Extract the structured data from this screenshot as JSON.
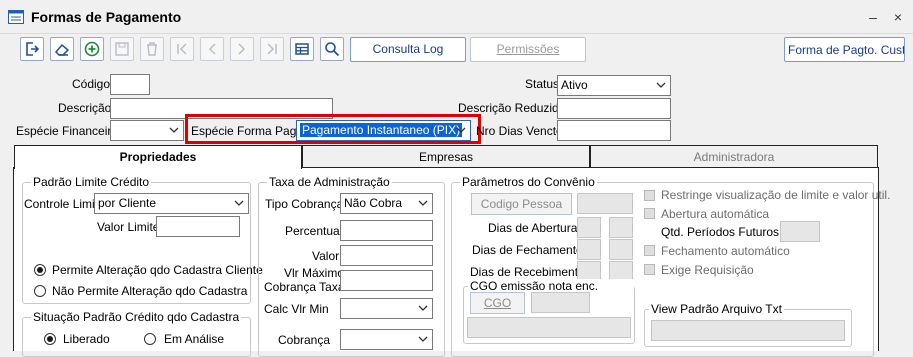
{
  "window": {
    "title": "Formas de Pagamento",
    "minimize_glyph": "–",
    "close_glyph": "×"
  },
  "toolbar": {
    "icons": [
      "exit-icon",
      "eraser-icon",
      "add-icon",
      "save-icon",
      "delete-icon",
      "first-icon",
      "previous-icon",
      "next-icon",
      "last-icon",
      "grid-icon",
      "search-icon"
    ],
    "consulta_log": "Consulta Log",
    "permissoes": "Permissões",
    "forma_pagto_custom": "Forma de Pagto. Custom"
  },
  "form": {
    "codigo_label": "Código",
    "codigo_value": "",
    "status_label": "Status",
    "status_value": "Ativo",
    "descricao_label": "Descrição",
    "descricao_value": "",
    "descricao_reduzida_label": "Descrição Reduzida",
    "descricao_reduzida_value": "",
    "especie_financeira_label": "Espécie Financeira",
    "especie_financeira_value": "",
    "especie_forma_pagto_label": "Espécie Forma Pagto",
    "especie_forma_pagto_value": "Pagamento Instantaneo (PIX)",
    "nro_dias_vencto_label": "Nro Dias Vencto",
    "nro_dias_vencto_value": ""
  },
  "tabs": [
    {
      "label": "Propriedades",
      "active": true
    },
    {
      "label": "Empresas",
      "active": false
    },
    {
      "label": "Administradora",
      "active": false,
      "disabled": true
    }
  ],
  "padrao_limite": {
    "title": "Padrão Limite Crédito",
    "controle_limite_label": "Controle Limite",
    "controle_limite_value": "por Cliente",
    "valor_limite_label": "Valor Limite",
    "valor_limite_value": "",
    "radio_permite": "Permite Alteração qdo Cadastra Cliente",
    "radio_nao_permite": "Não Permite Alteração qdo Cadastra",
    "selected": "permite"
  },
  "situacao": {
    "title": "Situação Padrão Crédito qdo Cadastra",
    "radio_liberado": "Liberado",
    "radio_em_analise": "Em Análise",
    "selected": "liberado"
  },
  "taxa": {
    "title": "Taxa de Administração",
    "tipo_cobranca_label": "Tipo Cobrança",
    "tipo_cobranca_value": "Não Cobra",
    "percentual_label": "Percentual",
    "valor_label": "Valor",
    "vlr_maximo_label_1": "Vlr Máximo",
    "vlr_maximo_label_2": "Cobrança Taxa",
    "calc_vlr_min_label": "Calc Vlr Min",
    "cobranca_label": "Cobrança"
  },
  "convenio": {
    "title": "Parâmetros do Convênio",
    "codigo_pessoa_button": "Codigo Pessoa",
    "dias_abertura_label": "Dias de Abertura",
    "dias_fechamento_label": "Dias de Fechamento",
    "dias_recebimento_label": "Dias de Recebimento",
    "cgo_group_title": "CGO emissão nota enc. conv.:",
    "cgo_button": "CGO",
    "restringe_label": "Restringe visualização de limite e valor util.",
    "abertura_auto_label": "Abertura automática",
    "qtd_periodos_label": "Qtd. Períodos Futuros",
    "fechamento_auto_label": "Fechamento automático",
    "exige_requisicao_label": "Exige Requisição",
    "view_padrao_title": "View Padrão Arquivo Txt"
  },
  "colors": {
    "accent": "#0a64d6",
    "highlight_border": "#e00000"
  }
}
